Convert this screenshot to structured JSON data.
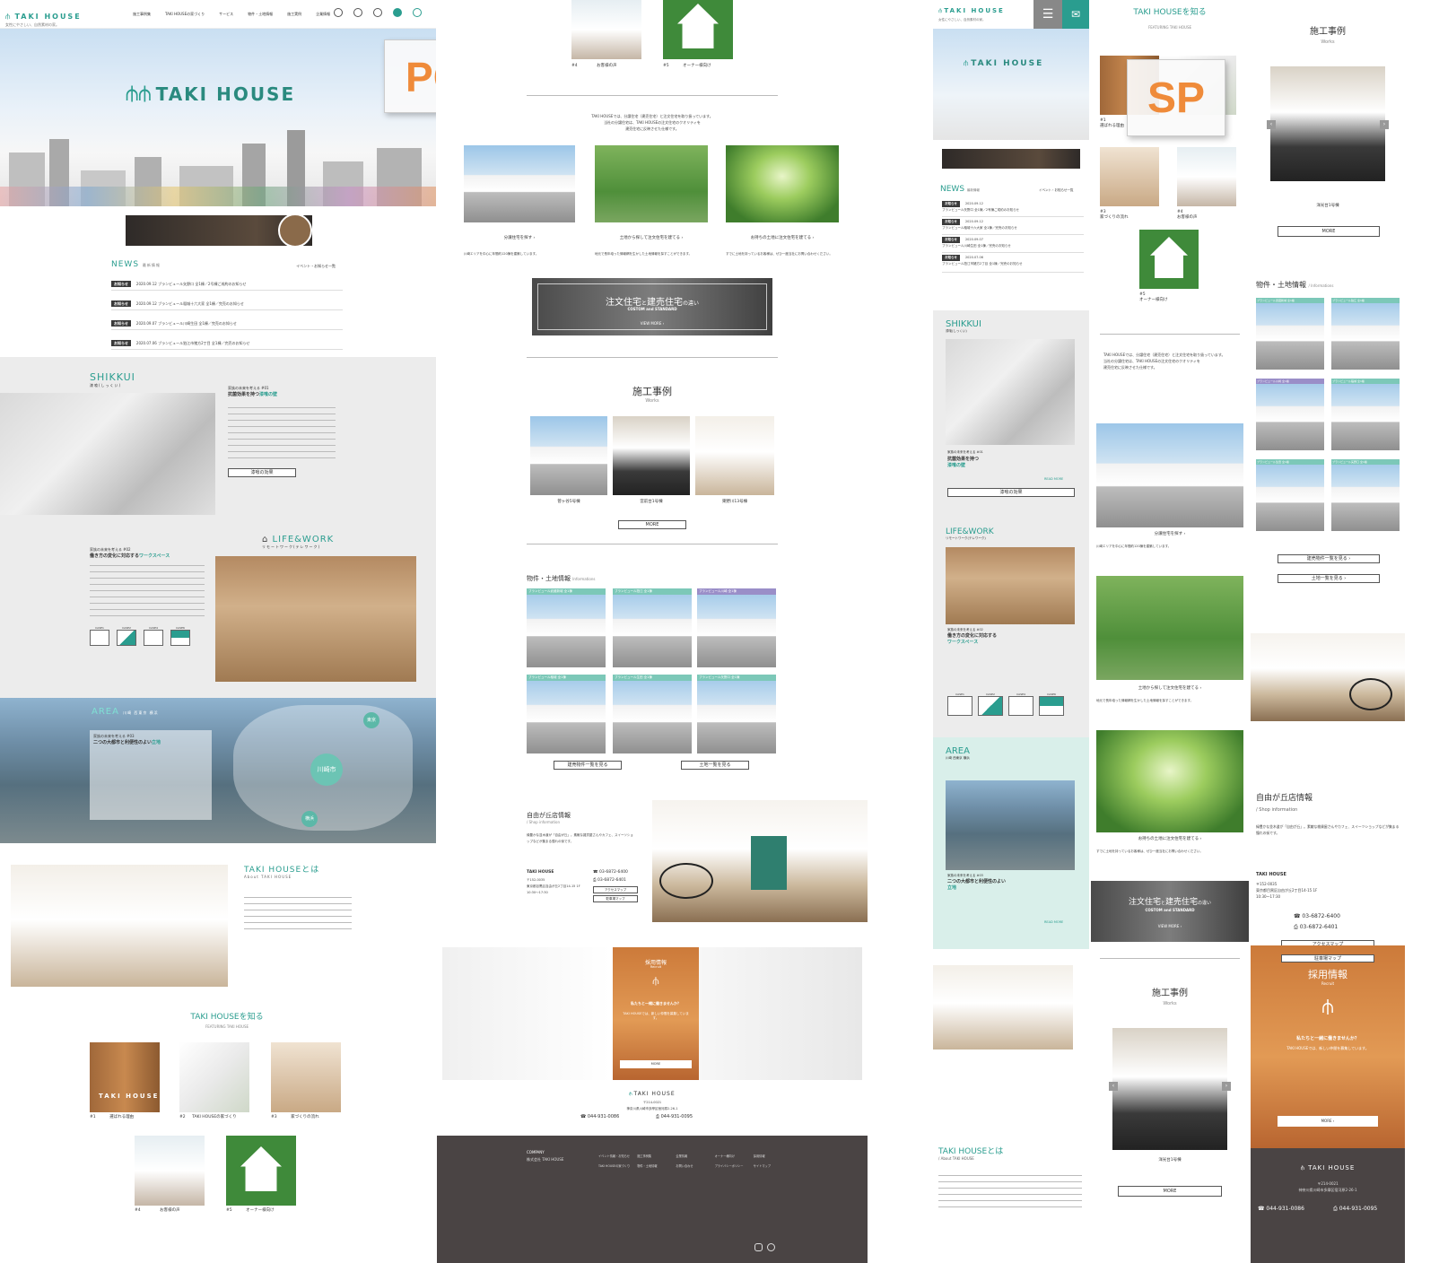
{
  "labels": {
    "pc": "PC",
    "sp": "SP"
  },
  "brand": {
    "name": "TAKI HOUSE",
    "tagline": "女性にやさしい、自然素材の家。"
  },
  "pc_nav": [
    "施工事例集",
    "TAKI HOUSEの家づくり",
    "サービス",
    "物件・土地情報",
    "施工実例",
    "企業情報"
  ],
  "hero": {
    "logo_text": "TAKI HOUSE"
  },
  "news": {
    "title": "NEWS",
    "title_sub": "最新情報",
    "more": "イベント・お知らせ一覧",
    "items": [
      {
        "tag": "お知らせ",
        "date": "2020.09.12",
        "text": "ブランビュール矢野口 全1棟／2号棟ご成約のお知らせ"
      },
      {
        "tag": "お知らせ",
        "date": "2020.09.12",
        "text": "ブランビュール稲城十六大家 全1棟／完売のお知らせ"
      },
      {
        "tag": "お知らせ",
        "date": "2020.09.07",
        "text": "ブランビュール川崎生田 全1棟／完売のお知らせ"
      },
      {
        "tag": "お知らせ",
        "date": "2020.07.06",
        "text": "ブランビュール狛江市猪方2丁目 全1棟／完売のお知らせ"
      }
    ]
  },
  "shikkui": {
    "title": "SHIKKUI",
    "sub": "漆喰(しっくい)",
    "kicker": "家族の未来を考える #01",
    "heading1": "抗菌効果を持つ",
    "heading2": "漆喰の壁",
    "more": "漆喰の効果",
    "readmore": "READ MORE"
  },
  "lifework": {
    "title": "LIFE&WORK",
    "sub": "リモートワーク(テレワーク)",
    "kicker": "家族の未来を考える #02",
    "heading1": "働き方の変化に対応する",
    "heading2": "ワークスペース",
    "cases": [
      "CASE1",
      "CASE2",
      "CASE4",
      "CASE6"
    ]
  },
  "area": {
    "title": "AREA",
    "sub": "川崎 西東京 横浜",
    "kicker": "家族の未来を考える #03",
    "heading1": "二つの大都市と利便性のよい",
    "heading2": "立地",
    "pins": [
      "東京",
      "川崎市",
      "横浜"
    ]
  },
  "about": {
    "title": "TAKI HOUSEとは",
    "sub": "About TAKI HOUSE"
  },
  "featuring": {
    "title": "TAKI HOUSEを知る",
    "sub": "FEATURING TAKI HOUSE",
    "items": [
      {
        "num": "#1",
        "label": "選ばれる理由"
      },
      {
        "num": "#2",
        "label": "TAKI HOUSEの家づくり"
      },
      {
        "num": "#3",
        "label": "家づくりの流れ"
      },
      {
        "num": "#4",
        "label": "お客様の声"
      },
      {
        "num": "#5",
        "label": "オーナー様向け"
      }
    ]
  },
  "intro": {
    "line1": "TAKI HOUSEでは、分譲住宅（建売住宅）と注文住宅を取り扱っています。",
    "line2": "当社の分譲住宅は、TAKI HOUSEの注文住宅のクオリティを",
    "line3": "建売住宅に反映させた仕様です。"
  },
  "services": [
    {
      "label": "分譲住宅を探す",
      "desc": "川崎エリアを中心に年間約120棟を建築しています。"
    },
    {
      "label": "土地から探して注文住宅を建てる",
      "desc": "地元で長年培った情報網を生かした土地情報を探すことができます。"
    },
    {
      "label": "お持ちの土地に注文住宅を建てる",
      "desc": "すでに土地を持っているお客様は、ぜひ一度当社にお問い合わせください。"
    }
  ],
  "banner": {
    "title1": "注文住宅",
    "and": "と",
    "title2": "建売住宅",
    "tail": "の違い",
    "en": "COSTOM and STANDARD",
    "more": "VIEW MORE"
  },
  "works": {
    "title": "施工事例",
    "sub": "Works",
    "items": [
      "菅ヶ谷5号棟",
      "宮前台1号棟",
      "東野川13号棟"
    ],
    "sp_item": "洋光台1号棟",
    "more": "MORE"
  },
  "info": {
    "title": "物件・土地情報",
    "sub": "Informations",
    "cards": [
      "ブランビュール武蔵新城 全1棟",
      "ブランビュール狛江 全1棟",
      "ブランビュール川崎 全1棟",
      "ブランビュール稲城 全1棟",
      "ブランビュール生田 全1棟",
      "ブランビュール矢野口 全1棟"
    ],
    "btn1": "建売物件一覧を見る",
    "btn2": "土地一覧を見る"
  },
  "shop": {
    "title": "自由が丘店情報",
    "sub": "Shop information",
    "desc": "緑豊かな並木道が「自由が丘」。素敵な雑貨屋さんやカフェ、スイーツショップなどが集まる憧れの街です。",
    "name": "TAKI HOUSE",
    "zip": "〒152-0035",
    "addr": "東京都目黒区自由が丘2丁目14-15 1F",
    "hours": "10:30～17:30",
    "tel": "03-6872-6400",
    "fax": "03-6872-6401",
    "access": "アクセスマップ",
    "parking": "駐車場マップ"
  },
  "recruit": {
    "title": "採用情報",
    "sub": "Recruit",
    "catch": "私たちと一緒に働きませんか？",
    "body": "TAKI HOUSEでは、新しい仲間を募集しています。",
    "more": "MORE"
  },
  "footer": {
    "zip": "〒214-0021",
    "addr": "神奈川県川崎市多摩区宿河原2-26-1",
    "tel": "044-931-0086",
    "fax": "044-931-0095",
    "company_label": "COMPANY",
    "company": "株式会社 TAKI HOUSE",
    "links": [
      "イベント情報・お知らせ",
      "施工事例集",
      "企業情報",
      "オーナー様向け",
      "採用情報",
      "TAKI HOUSEの家づくり",
      "物件・土地情報",
      "お問い合わせ",
      "プライバシーポリシー",
      "サイトマップ"
    ]
  },
  "colors": {
    "accent": "#2a9d8f",
    "tag_text": "#ef8b3a",
    "footer": "#4a4444",
    "recruit": "#d4874a"
  }
}
